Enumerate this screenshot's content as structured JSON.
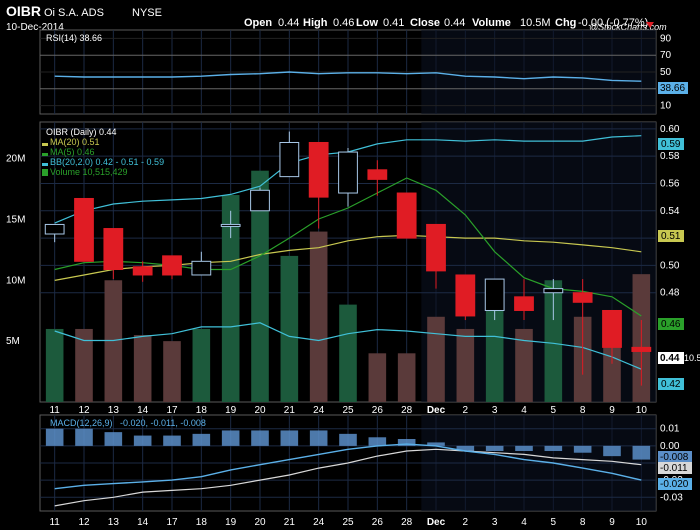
{
  "header": {
    "symbol": "OIBR",
    "company": "Oi S.A. ADS",
    "exchange": "NYSE",
    "date": "10-Dec-2014",
    "open_label": "Open",
    "open": "0.44",
    "high_label": "High",
    "high": "0.46",
    "low_label": "Low",
    "low": "0.41",
    "close_label": "Close",
    "close": "0.44",
    "volume_label": "Volume",
    "volume": "10.5M",
    "chg_label": "Chg",
    "chg": "-0.00 (-0.77%)",
    "watermark": "@StockCharts.com"
  },
  "colors": {
    "up": "#3a78c8",
    "down": "#e01c24",
    "rsi": "#5bb0e8",
    "ma20": "#c8c850",
    "ma5": "#2aa02a",
    "bb": "#40c0d8",
    "macd": "#5bb0e8",
    "signal": "#d8d8d8",
    "histogram": "#5b8ec8",
    "vol_up": "#1c5a3c",
    "vol_down": "#5a3a3a"
  },
  "chart_data": {
    "type": "candlestick",
    "x_labels": [
      "11",
      "12",
      "13",
      "14",
      "17",
      "18",
      "19",
      "20",
      "21",
      "24",
      "25",
      "26",
      "28",
      "Dec",
      "2",
      "3",
      "4",
      "5",
      "8",
      "9",
      "10"
    ],
    "candles": [
      {
        "open": 0.523,
        "high": 0.528,
        "low": 0.517,
        "close": 0.53
      },
      {
        "open": 0.549,
        "high": 0.549,
        "low": 0.503,
        "close": 0.503
      },
      {
        "open": 0.527,
        "high": 0.527,
        "low": 0.49,
        "close": 0.497
      },
      {
        "open": 0.499,
        "high": 0.503,
        "low": 0.488,
        "close": 0.493
      },
      {
        "open": 0.507,
        "high": 0.507,
        "low": 0.49,
        "close": 0.493
      },
      {
        "open": 0.493,
        "high": 0.51,
        "low": 0.493,
        "close": 0.503
      },
      {
        "open": 0.53,
        "high": 0.54,
        "low": 0.52,
        "close": 0.53
      },
      {
        "open": 0.54,
        "high": 0.557,
        "low": 0.54,
        "close": 0.555
      },
      {
        "open": 0.565,
        "high": 0.598,
        "low": 0.565,
        "close": 0.59
      },
      {
        "open": 0.59,
        "high": 0.59,
        "low": 0.527,
        "close": 0.55
      },
      {
        "open": 0.553,
        "high": 0.586,
        "low": 0.543,
        "close": 0.583
      },
      {
        "open": 0.57,
        "high": 0.577,
        "low": 0.551,
        "close": 0.563
      },
      {
        "open": 0.553,
        "high": 0.553,
        "low": 0.52,
        "close": 0.52
      },
      {
        "open": 0.53,
        "high": 0.53,
        "low": 0.483,
        "close": 0.496
      },
      {
        "open": 0.493,
        "high": 0.493,
        "low": 0.46,
        "close": 0.463
      },
      {
        "open": 0.467,
        "high": 0.49,
        "low": 0.46,
        "close": 0.49
      },
      {
        "open": 0.477,
        "high": 0.49,
        "low": 0.46,
        "close": 0.467
      },
      {
        "open": 0.48,
        "high": 0.49,
        "low": 0.46,
        "close": 0.483
      },
      {
        "open": 0.48,
        "high": 0.49,
        "low": 0.42,
        "close": 0.473
      },
      {
        "open": 0.467,
        "high": 0.467,
        "low": 0.428,
        "close": 0.44
      },
      {
        "open": 0.44,
        "high": 0.46,
        "low": 0.412,
        "close": 0.437
      }
    ],
    "price_ylim": [
      0.4,
      0.605
    ],
    "price_ticks": [
      "0.60",
      "0.58",
      "0.56",
      "0.54",
      "0.52",
      "0.50",
      "0.48"
    ],
    "ma20": [
      0.489,
      0.493,
      0.497,
      0.499,
      0.5,
      0.502,
      0.503,
      0.508,
      0.511,
      0.513,
      0.518,
      0.521,
      0.522,
      0.521,
      0.52,
      0.52,
      0.518,
      0.517,
      0.515,
      0.513,
      0.51
    ],
    "ma5": [
      0.497,
      0.502,
      0.503,
      0.502,
      0.5,
      0.497,
      0.497,
      0.507,
      0.52,
      0.534,
      0.542,
      0.553,
      0.564,
      0.555,
      0.537,
      0.51,
      0.491,
      0.483,
      0.481,
      0.477,
      0.463
    ],
    "bb_upper": [
      0.531,
      0.54,
      0.545,
      0.547,
      0.548,
      0.549,
      0.552,
      0.558,
      0.575,
      0.581,
      0.583,
      0.589,
      0.592,
      0.592,
      0.591,
      0.592,
      0.591,
      0.591,
      0.591,
      0.594,
      0.595
    ],
    "bb_lower": [
      0.452,
      0.445,
      0.445,
      0.448,
      0.45,
      0.455,
      0.455,
      0.458,
      0.448,
      0.445,
      0.45,
      0.453,
      0.452,
      0.45,
      0.448,
      0.448,
      0.445,
      0.443,
      0.44,
      0.433,
      0.424
    ],
    "volume_values": [
      6,
      6,
      10,
      5.5,
      5,
      6,
      17,
      19,
      12,
      14,
      8,
      4,
      4,
      7,
      6,
      8.5,
      6,
      10,
      7,
      7.5,
      10.5
    ],
    "volume_ticks": [
      "20M",
      "15M",
      "10M",
      "5M"
    ],
    "volume_ylim": [
      0,
      23
    ],
    "rsi": [
      45,
      44,
      44,
      44,
      44,
      45,
      47,
      48,
      50,
      48,
      49,
      49,
      48,
      49,
      45,
      44,
      42,
      44,
      43,
      40,
      39
    ],
    "rsi_ylim": [
      0,
      100
    ],
    "rsi_ticks": [
      "90",
      "70",
      "50",
      "30",
      "10"
    ],
    "macd": [
      -0.025,
      -0.023,
      -0.022,
      -0.021,
      -0.02,
      -0.018,
      -0.014,
      -0.011,
      -0.008,
      -0.005,
      -0.002,
      0.0,
      0.001,
      0.0,
      -0.003,
      -0.005,
      -0.008,
      -0.01,
      -0.013,
      -0.016,
      -0.02
    ],
    "signal": [
      -0.035,
      -0.032,
      -0.03,
      -0.027,
      -0.026,
      -0.025,
      -0.023,
      -0.02,
      -0.017,
      -0.013,
      -0.01,
      -0.006,
      -0.003,
      -0.002,
      -0.003,
      -0.004,
      -0.005,
      -0.007,
      -0.008,
      -0.009,
      -0.011
    ],
    "histogram": [
      0.01,
      0.01,
      0.008,
      0.006,
      0.006,
      0.007,
      0.009,
      0.009,
      0.009,
      0.009,
      0.007,
      0.005,
      0.004,
      0.002,
      -0.003,
      -0.003,
      -0.003,
      -0.003,
      -0.004,
      -0.006,
      -0.008
    ],
    "macd_ylim": [
      -0.038,
      0.018
    ],
    "macd_ticks": [
      "0.01",
      "0.00",
      "-0.01",
      "-0.02",
      "-0.03"
    ],
    "legend": {
      "rsi": "RSI(14) 38.66",
      "price": "OIBR (Daily) 0.44",
      "ma20": "MA(20) 0.51",
      "ma5": "MA(5) 0.46",
      "bb": "BB(20,2.0) 0.42 - 0.51 - 0.59",
      "volume": "Volume 10,515,429",
      "macd_name": "MACD(12,26,9)",
      "macd_values": " -0.020, -0.011, -0.008"
    },
    "value_boxes": {
      "rsi": "38.66",
      "bb_upper": "0.59",
      "ma20": "0.51",
      "ma5": "0.46",
      "close": "0.44",
      "volume_label": "10.542",
      "bb_lower": "0.42",
      "macd_sig": "-0.011",
      "macd_val": "-0.020",
      "macd_hist": "-0.008"
    }
  }
}
